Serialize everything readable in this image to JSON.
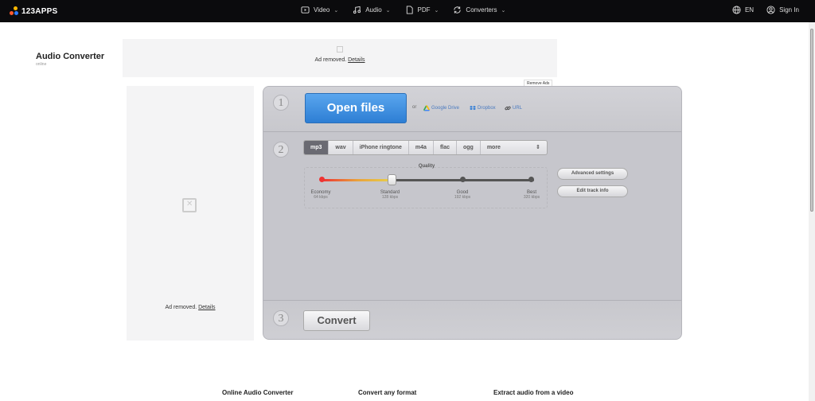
{
  "header": {
    "logo_text": "123APPS",
    "nav": [
      {
        "label": "Video",
        "icon": "video-icon"
      },
      {
        "label": "Audio",
        "icon": "music-icon"
      },
      {
        "label": "PDF",
        "icon": "pdf-icon"
      },
      {
        "label": "Converters",
        "icon": "converters-icon"
      }
    ],
    "chevron": "⌄",
    "language": "EN",
    "signin": "Sign In"
  },
  "page": {
    "title": "Audio Converter",
    "subtitle": "online"
  },
  "ads": {
    "removed_text": "Ad removed.",
    "details_link": "Details",
    "remove_ads_label": "Remove Ads"
  },
  "converter": {
    "steps": [
      "1",
      "2",
      "3"
    ],
    "open_files_label": "Open files",
    "or_label": "or",
    "sources": [
      {
        "label": "Google Drive",
        "icon": "google-drive-icon"
      },
      {
        "label": "Dropbox",
        "icon": "dropbox-icon"
      },
      {
        "label": "URL",
        "icon": "link-icon"
      }
    ],
    "formats": [
      "mp3",
      "wav",
      "iPhone ringtone",
      "m4a",
      "flac",
      "ogg",
      "more"
    ],
    "selected_format": "mp3",
    "more_arrow": "⇕",
    "quality": {
      "label": "Quality",
      "level_percent": 33,
      "marks": [
        {
          "name": "Economy",
          "bitrate": "64 kbps"
        },
        {
          "name": "Standard",
          "bitrate": "128 kbps"
        },
        {
          "name": "Good",
          "bitrate": "192 kbps"
        },
        {
          "name": "Best",
          "bitrate": "320 kbps"
        }
      ]
    },
    "advanced_settings_label": "Advanced settings",
    "edit_track_info_label": "Edit track info",
    "convert_label": "Convert"
  },
  "footer": {
    "columns": [
      "Online Audio Converter",
      "Convert any format",
      "Extract audio from a video"
    ]
  }
}
